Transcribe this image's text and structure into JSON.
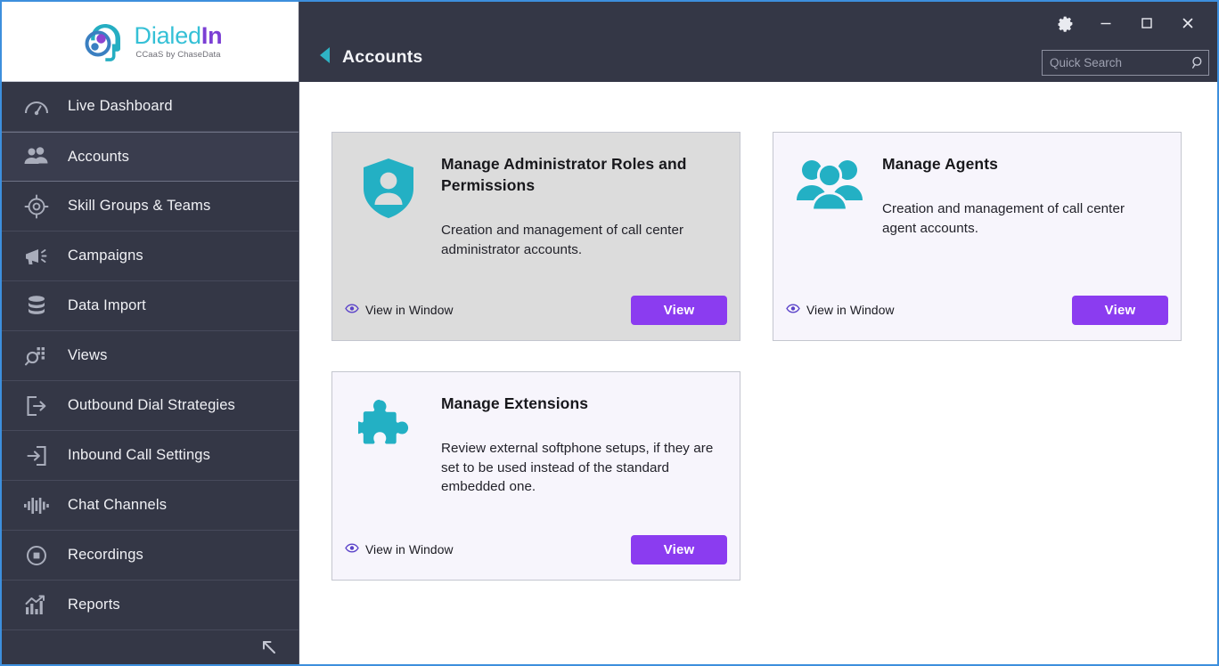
{
  "brand": {
    "name_part1": "Dialed",
    "name_part2": "In",
    "tagline": "CCaaS by ChaseData",
    "teal": "#35c0d6",
    "purple": "#7b3fd4"
  },
  "sidebar": {
    "items": [
      {
        "label": "Live Dashboard",
        "icon": "gauge-icon",
        "active": false
      },
      {
        "label": "Accounts",
        "icon": "people-icon",
        "active": true
      },
      {
        "label": "Skill Groups & Teams",
        "icon": "target-icon",
        "active": false
      },
      {
        "label": "Campaigns",
        "icon": "megaphone-icon",
        "active": false
      },
      {
        "label": "Data Import",
        "icon": "database-icon",
        "active": false
      },
      {
        "label": "Views",
        "icon": "magnifier-grid-icon",
        "active": false
      },
      {
        "label": "Outbound Dial Strategies",
        "icon": "arrow-out-icon",
        "active": false
      },
      {
        "label": "Inbound Call Settings",
        "icon": "arrow-in-icon",
        "active": false
      },
      {
        "label": "Chat Channels",
        "icon": "waveform-icon",
        "active": false
      },
      {
        "label": "Recordings",
        "icon": "record-icon",
        "active": false
      },
      {
        "label": "Reports",
        "icon": "chart-up-icon",
        "active": false
      }
    ],
    "collapse_icon": "collapse-arrow-icon"
  },
  "titlebar": {
    "back_icon": "back-arrow-icon",
    "page_title": "Accounts",
    "window_buttons": [
      {
        "name": "settings",
        "icon": "gear-icon"
      },
      {
        "name": "minimize",
        "icon": "minimize-icon"
      },
      {
        "name": "maximize",
        "icon": "maximize-icon"
      },
      {
        "name": "close",
        "icon": "close-icon"
      }
    ]
  },
  "search": {
    "placeholder": "Quick Search",
    "value": "",
    "icon": "search-icon"
  },
  "cards": [
    {
      "title": "Manage Administrator Roles and Permissions",
      "description": "Creation and management of call center administrator accounts.",
      "icon": "shield-person-icon",
      "link_label": "View in Window",
      "button_label": "View",
      "hovered": true
    },
    {
      "title": "Manage Agents",
      "description": "Creation and management of call center agent accounts.",
      "icon": "people-group-icon",
      "link_label": "View in Window",
      "button_label": "View",
      "hovered": false
    },
    {
      "title": "Manage Extensions",
      "description": "Review external softphone setups, if they are set to be used instead of the standard embedded one.",
      "icon": "puzzle-piece-icon",
      "link_label": "View in Window",
      "button_label": "View",
      "hovered": false
    }
  ],
  "colors": {
    "window_border": "#3d8fdd",
    "sidebar_bg": "#343746",
    "accent_teal": "#23b0c4",
    "accent_purple": "#8b3cf0",
    "card_bg": "#f7f5fc",
    "card_hover_bg": "#dcdcdc"
  }
}
